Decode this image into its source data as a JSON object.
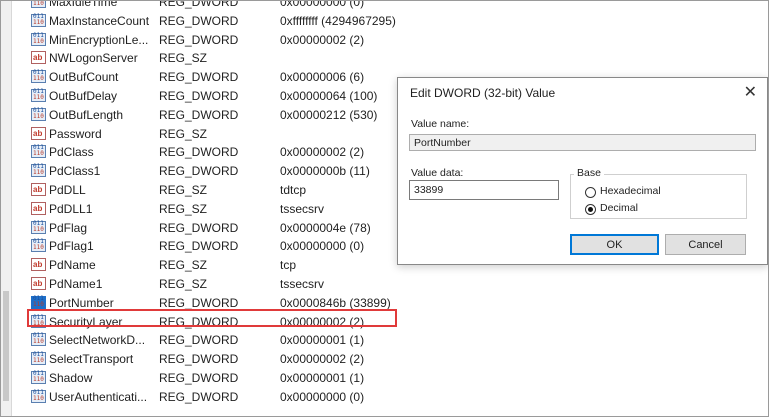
{
  "rows": [
    {
      "name": "MaxIdleTime",
      "type": "REG_DWORD",
      "data": "0x00000000 (0)",
      "icon": "binary"
    },
    {
      "name": "MaxInstanceCount",
      "type": "REG_DWORD",
      "data": "0xffffffff (4294967295)",
      "icon": "binary"
    },
    {
      "name": "MinEncryptionLe...",
      "type": "REG_DWORD",
      "data": "0x00000002 (2)",
      "icon": "binary"
    },
    {
      "name": "NWLogonServer",
      "type": "REG_SZ",
      "data": "",
      "icon": "string"
    },
    {
      "name": "OutBufCount",
      "type": "REG_DWORD",
      "data": "0x00000006 (6)",
      "icon": "binary"
    },
    {
      "name": "OutBufDelay",
      "type": "REG_DWORD",
      "data": "0x00000064 (100)",
      "icon": "binary"
    },
    {
      "name": "OutBufLength",
      "type": "REG_DWORD",
      "data": "0x00000212 (530)",
      "icon": "binary"
    },
    {
      "name": "Password",
      "type": "REG_SZ",
      "data": "",
      "icon": "string"
    },
    {
      "name": "PdClass",
      "type": "REG_DWORD",
      "data": "0x00000002 (2)",
      "icon": "binary"
    },
    {
      "name": "PdClass1",
      "type": "REG_DWORD",
      "data": "0x0000000b (11)",
      "icon": "binary"
    },
    {
      "name": "PdDLL",
      "type": "REG_SZ",
      "data": "tdtcp",
      "icon": "string"
    },
    {
      "name": "PdDLL1",
      "type": "REG_SZ",
      "data": "tssecsrv",
      "icon": "string"
    },
    {
      "name": "PdFlag",
      "type": "REG_DWORD",
      "data": "0x0000004e (78)",
      "icon": "binary"
    },
    {
      "name": "PdFlag1",
      "type": "REG_DWORD",
      "data": "0x00000000 (0)",
      "icon": "binary"
    },
    {
      "name": "PdName",
      "type": "REG_SZ",
      "data": "tcp",
      "icon": "string"
    },
    {
      "name": "PdName1",
      "type": "REG_SZ",
      "data": "tssecsrv",
      "icon": "string"
    },
    {
      "name": "PortNumber",
      "type": "REG_DWORD",
      "data": "0x0000846b (33899)",
      "icon": "binary"
    },
    {
      "name": "SecurityLayer",
      "type": "REG_DWORD",
      "data": "0x00000002 (2)",
      "icon": "binary"
    },
    {
      "name": "SelectNetworkD...",
      "type": "REG_DWORD",
      "data": "0x00000001 (1)",
      "icon": "binary"
    },
    {
      "name": "SelectTransport",
      "type": "REG_DWORD",
      "data": "0x00000002 (2)",
      "icon": "binary"
    },
    {
      "name": "Shadow",
      "type": "REG_DWORD",
      "data": "0x00000001 (1)",
      "icon": "binary"
    },
    {
      "name": "UserAuthenticati...",
      "type": "REG_DWORD",
      "data": "0x00000000 (0)",
      "icon": "binary"
    }
  ],
  "selected_index": 16,
  "highlight_color": "#e03a3a",
  "dialog": {
    "title": "Edit DWORD (32-bit) Value",
    "close_glyph": "✕",
    "value_name_label": "Value name:",
    "value_name": "PortNumber",
    "value_data_label": "Value data:",
    "value_data": "33899",
    "base_label": "Base",
    "hex_label": "Hexadecimal",
    "dec_label": "Decimal",
    "selected_base": "Decimal",
    "ok_label": "OK",
    "cancel_label": "Cancel"
  }
}
